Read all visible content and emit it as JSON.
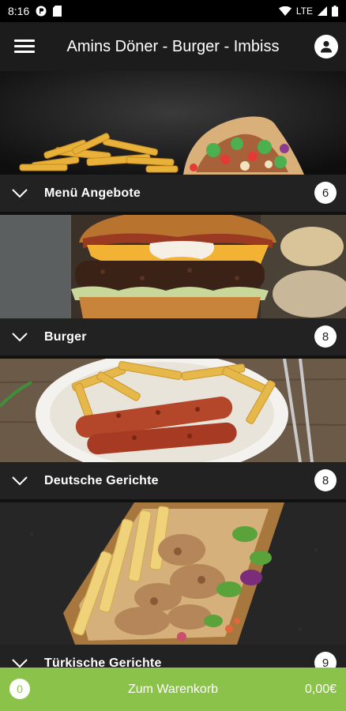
{
  "status_bar": {
    "time": "8:16",
    "network": "LTE"
  },
  "app_bar": {
    "title": "Amins Döner - Burger - Imbiss",
    "menu_icon": "hamburger-menu-icon",
    "profile_icon": "account-icon"
  },
  "categories": [
    {
      "label": "Menü Angebote",
      "count": "6",
      "image": "doner-with-fries-photo"
    },
    {
      "label": "Burger",
      "count": "8",
      "image": "cheeseburger-photo"
    },
    {
      "label": "Deutsche Gerichte",
      "count": "8",
      "image": "currywurst-with-fries-photo"
    },
    {
      "label": "Türkische Gerichte",
      "count": "9",
      "image": "doner-box-photo"
    }
  ],
  "cart": {
    "count": "0",
    "label": "Zum Warenkorb",
    "total": "0,00€"
  },
  "colors": {
    "accent_green": "#8bc34a",
    "bar_dark": "#222222",
    "app_bar": "#1c1c1c"
  }
}
